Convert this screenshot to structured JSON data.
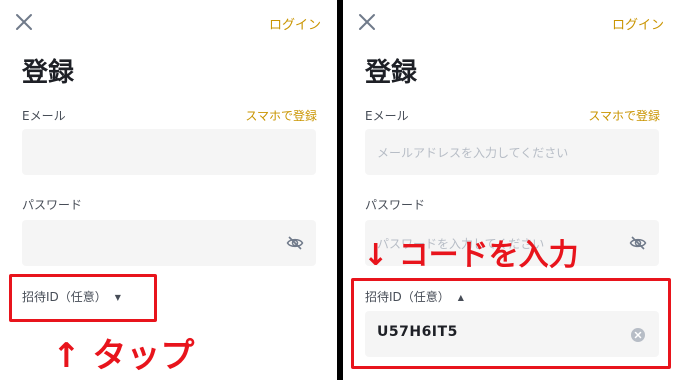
{
  "left": {
    "login_link": "ログイン",
    "title": "登録",
    "email_label": "Eメール",
    "phone_register_link": "スマホで登録",
    "password_label": "パスワード",
    "referral_label": "招待ID（任意）",
    "referral_caret": "▼",
    "annotation": "↑ タップ"
  },
  "right": {
    "login_link": "ログイン",
    "title": "登録",
    "email_label": "Eメール",
    "phone_register_link": "スマホで登録",
    "email_placeholder": "メールアドレスを入力してください",
    "password_label": "パスワード",
    "password_placeholder": "パスワードを入力してください",
    "referral_label": "招待ID（任意）",
    "referral_caret": "▲",
    "referral_value": "U57H6IT5",
    "annotation": "↓ コードを入力"
  },
  "colors": {
    "accent": "#c99400",
    "annotation_red": "#e8141c",
    "field_bg": "#f5f5f5"
  },
  "icons": [
    "close-icon",
    "eye-off-icon",
    "clear-icon",
    "caret-down-icon",
    "caret-up-icon"
  ]
}
